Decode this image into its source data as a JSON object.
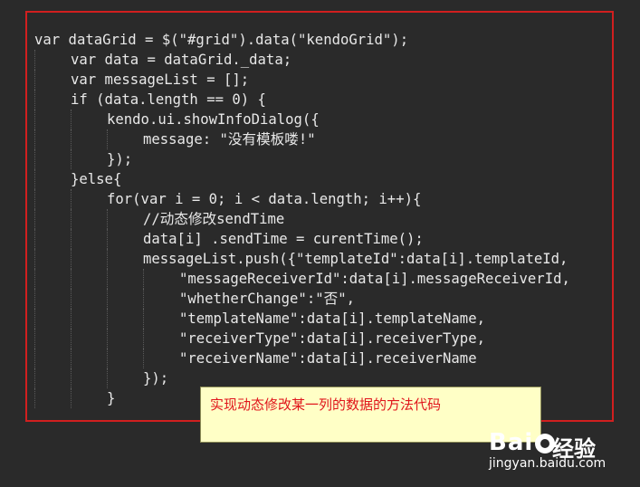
{
  "code_lines": [
    {
      "indent": 0,
      "text": "var dataGrid = $(\"#grid\").data(\"kendoGrid\");"
    },
    {
      "indent": 1,
      "text": "var data = dataGrid._data;"
    },
    {
      "indent": 1,
      "text": "var messageList = [];"
    },
    {
      "indent": 1,
      "text": "if (data.length == 0) {"
    },
    {
      "indent": 2,
      "text": "kendo.ui.showInfoDialog({"
    },
    {
      "indent": 3,
      "text": "message: \"没有模板喽!\""
    },
    {
      "indent": 2,
      "text": "});"
    },
    {
      "indent": 1,
      "text": "}else{"
    },
    {
      "indent": 2,
      "text": "for(var i = 0; i < data.length; i++){"
    },
    {
      "indent": 3,
      "text": "//动态修改sendTime"
    },
    {
      "indent": 3,
      "text": "data[i] .sendTime = curentTime();"
    },
    {
      "indent": 3,
      "text": "messageList.push({\"templateId\":data[i].templateId,"
    },
    {
      "indent": 4,
      "text": "\"messageReceiverId\":data[i].messageReceiverId,"
    },
    {
      "indent": 4,
      "text": "\"whetherChange\":\"否\","
    },
    {
      "indent": 4,
      "text": "\"templateName\":data[i].templateName,"
    },
    {
      "indent": 4,
      "text": "\"receiverType\":data[i].receiverType,"
    },
    {
      "indent": 4,
      "text": "\"receiverName\":data[i].receiverName"
    },
    {
      "indent": 3,
      "text": "});"
    },
    {
      "indent": 2,
      "text": "}"
    }
  ],
  "callout": {
    "text": "实现动态修改某一列的数据的方法代码"
  },
  "watermark": {
    "brand": "Bai du",
    "suffix": "经验",
    "url": "jingyan.baidu.com"
  },
  "colors": {
    "frame": "#d11f1f",
    "callout_bg": "#ffffc6",
    "callout_text": "#e0151b",
    "code_text": "#e8e8e8",
    "background": "#2a2a2a"
  }
}
